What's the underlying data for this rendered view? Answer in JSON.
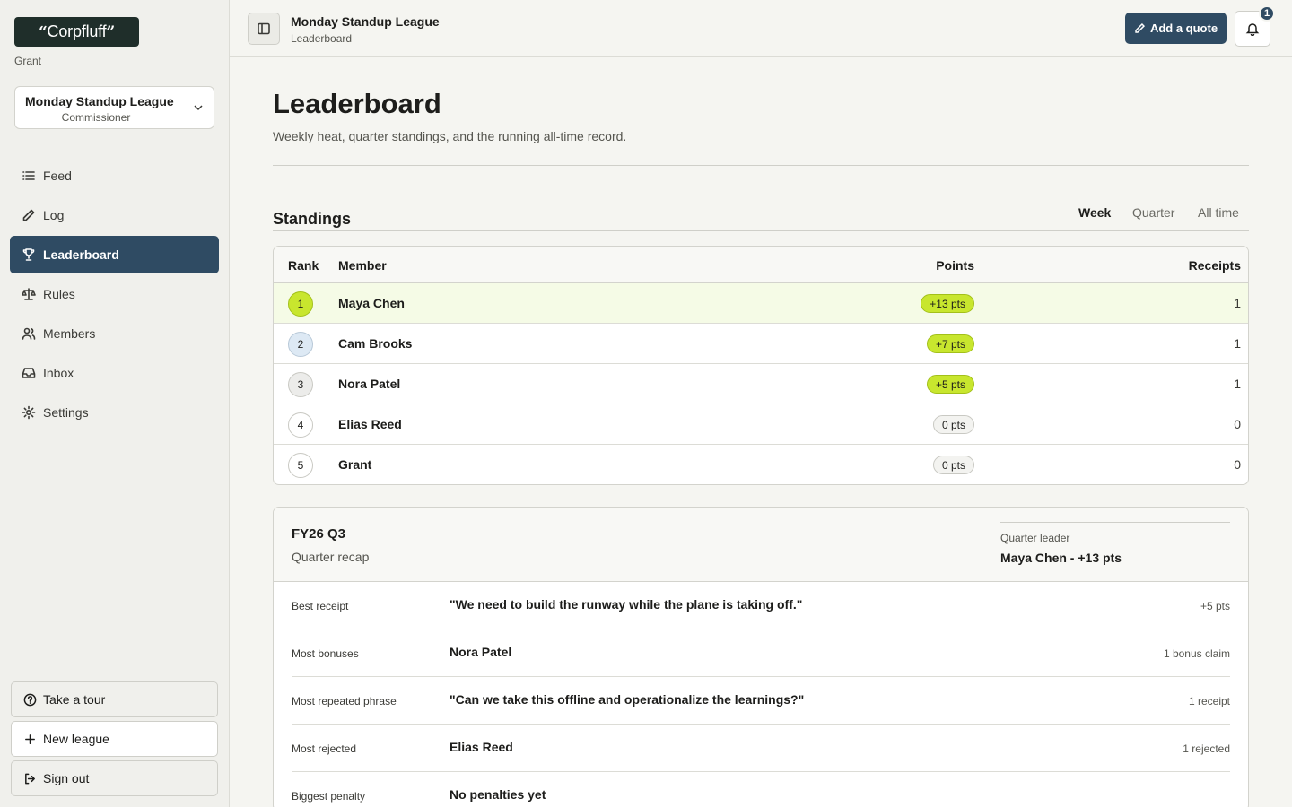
{
  "app": {
    "logo_text": "Corpfluff",
    "user_name": "Grant"
  },
  "league_selector": {
    "name": "Monday Standup League",
    "role": "Commissioner"
  },
  "sidebar": {
    "items": [
      {
        "label": "Feed",
        "icon": "list-icon",
        "active": false
      },
      {
        "label": "Log",
        "icon": "pencil-icon",
        "active": false
      },
      {
        "label": "Leaderboard",
        "icon": "trophy-icon",
        "active": true
      },
      {
        "label": "Rules",
        "icon": "scale-icon",
        "active": false
      },
      {
        "label": "Members",
        "icon": "users-icon",
        "active": false
      },
      {
        "label": "Inbox",
        "icon": "inbox-icon",
        "active": false
      },
      {
        "label": "Settings",
        "icon": "gear-icon",
        "active": false
      }
    ],
    "take_tour": "Take a tour",
    "new_league": "New league",
    "sign_out": "Sign out"
  },
  "topbar": {
    "title": "Monday Standup League",
    "subtitle": "Leaderboard",
    "add_quote": "Add a quote",
    "notifications_count": "1"
  },
  "page": {
    "title": "Leaderboard",
    "subtitle": "Weekly heat, quarter standings, and the running all-time record."
  },
  "standings": {
    "title": "Standings",
    "tabs": [
      "Week",
      "Quarter",
      "All time"
    ],
    "active_tab": "Week",
    "columns": {
      "rank": "Rank",
      "member": "Member",
      "points": "Points",
      "receipts": "Receipts"
    },
    "rows": [
      {
        "rank": "1",
        "member": "Maya Chen",
        "points": "+13 pts",
        "receipts": "1"
      },
      {
        "rank": "2",
        "member": "Cam Brooks",
        "points": "+7 pts",
        "receipts": "1"
      },
      {
        "rank": "3",
        "member": "Nora Patel",
        "points": "+5 pts",
        "receipts": "1"
      },
      {
        "rank": "4",
        "member": "Elias Reed",
        "points": "0 pts",
        "receipts": "0"
      },
      {
        "rank": "5",
        "member": "Grant",
        "points": "0 pts",
        "receipts": "0"
      }
    ]
  },
  "recap": {
    "quarter": "FY26 Q3",
    "subtitle": "Quarter recap",
    "leader_label": "Quarter leader",
    "leader_value": "Maya Chen - +13 pts",
    "rows": [
      {
        "label": "Best receipt",
        "value": "\"We need to build the runway while the plane is taking off.\"",
        "meta": "+5 pts"
      },
      {
        "label": "Most bonuses",
        "value": "Nora Patel",
        "meta": "1 bonus claim"
      },
      {
        "label": "Most repeated phrase",
        "value": "\"Can we take this offline and operationalize the learnings?\"",
        "meta": "1 receipt"
      },
      {
        "label": "Most rejected",
        "value": "Elias Reed",
        "meta": "1 rejected"
      },
      {
        "label": "Biggest penalty",
        "value": "No penalties yet",
        "meta": ""
      }
    ]
  },
  "colors": {
    "accent": "#2f4b63",
    "highlight": "#c8e62e",
    "background": "#f5f5f1"
  }
}
